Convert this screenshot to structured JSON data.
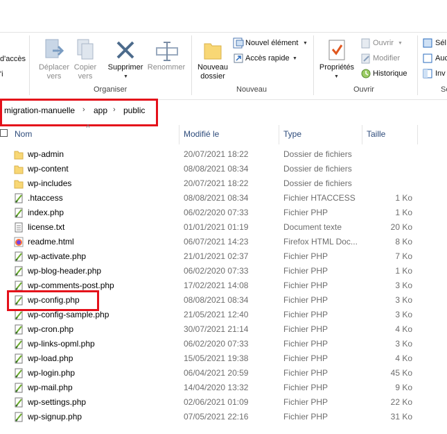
{
  "ribbon": {
    "partial_left": [
      "d'accès",
      "'i"
    ],
    "organiser": {
      "label": "Organiser",
      "deplacer": [
        "Déplacer",
        "vers"
      ],
      "copier": [
        "Copier",
        "vers"
      ],
      "supprimer": "Supprimer",
      "renommer": "Renommer"
    },
    "nouveau": {
      "label": "Nouveau",
      "nouveau_dossier": [
        "Nouveau",
        "dossier"
      ],
      "nouvel_element": "Nouvel élément",
      "acces_rapide": "Accès rapide"
    },
    "ouvrir": {
      "label": "Ouvrir",
      "proprietes": "Propriétés",
      "ouvrir": "Ouvrir",
      "modifier": "Modifier",
      "historique": "Historique"
    },
    "partial_right": [
      "Sél",
      "Auc",
      "Inv",
      "Sé"
    ]
  },
  "breadcrumb": [
    "migration-manuelle",
    "app",
    "public"
  ],
  "columns": {
    "name": "Nom",
    "modified": "Modifié le",
    "type": "Type",
    "size": "Taille"
  },
  "files": [
    {
      "name": "wp-admin",
      "date": "20/07/2021 18:22",
      "type": "Dossier de fichiers",
      "size": "",
      "icon": "folder"
    },
    {
      "name": "wp-content",
      "date": "08/08/2021 08:34",
      "type": "Dossier de fichiers",
      "size": "",
      "icon": "folder"
    },
    {
      "name": "wp-includes",
      "date": "20/07/2021 18:22",
      "type": "Dossier de fichiers",
      "size": "",
      "icon": "folder"
    },
    {
      "name": ".htaccess",
      "date": "08/08/2021 08:34",
      "type": "Fichier HTACCESS",
      "size": "1 Ko",
      "icon": "php"
    },
    {
      "name": "index.php",
      "date": "06/02/2020 07:33",
      "type": "Fichier PHP",
      "size": "1 Ko",
      "icon": "php"
    },
    {
      "name": "license.txt",
      "date": "01/01/2021 01:19",
      "type": "Document texte",
      "size": "20 Ko",
      "icon": "txt"
    },
    {
      "name": "readme.html",
      "date": "06/07/2021 14:23",
      "type": "Firefox HTML Doc...",
      "size": "8 Ko",
      "icon": "firefox"
    },
    {
      "name": "wp-activate.php",
      "date": "21/01/2021 02:37",
      "type": "Fichier PHP",
      "size": "7 Ko",
      "icon": "php"
    },
    {
      "name": "wp-blog-header.php",
      "date": "06/02/2020 07:33",
      "type": "Fichier PHP",
      "size": "1 Ko",
      "icon": "php"
    },
    {
      "name": "wp-comments-post.php",
      "date": "17/02/2021 14:08",
      "type": "Fichier PHP",
      "size": "3 Ko",
      "icon": "php"
    },
    {
      "name": "wp-config.php",
      "date": "08/08/2021 08:34",
      "type": "Fichier PHP",
      "size": "3 Ko",
      "icon": "php"
    },
    {
      "name": "wp-config-sample.php",
      "date": "21/05/2021 12:40",
      "type": "Fichier PHP",
      "size": "3 Ko",
      "icon": "php"
    },
    {
      "name": "wp-cron.php",
      "date": "30/07/2021 21:14",
      "type": "Fichier PHP",
      "size": "4 Ko",
      "icon": "php"
    },
    {
      "name": "wp-links-opml.php",
      "date": "06/02/2020 07:33",
      "type": "Fichier PHP",
      "size": "3 Ko",
      "icon": "php"
    },
    {
      "name": "wp-load.php",
      "date": "15/05/2021 19:38",
      "type": "Fichier PHP",
      "size": "4 Ko",
      "icon": "php"
    },
    {
      "name": "wp-login.php",
      "date": "06/04/2021 20:59",
      "type": "Fichier PHP",
      "size": "45 Ko",
      "icon": "php"
    },
    {
      "name": "wp-mail.php",
      "date": "14/04/2020 13:32",
      "type": "Fichier PHP",
      "size": "9 Ko",
      "icon": "php"
    },
    {
      "name": "wp-settings.php",
      "date": "02/06/2021 01:09",
      "type": "Fichier PHP",
      "size": "22 Ko",
      "icon": "php"
    },
    {
      "name": "wp-signup.php",
      "date": "07/05/2021 22:16",
      "type": "Fichier PHP",
      "size": "31 Ko",
      "icon": "php"
    }
  ],
  "colors": {
    "highlight": "#e4101a",
    "folder": "#f8d775",
    "accent": "#1a73c9"
  }
}
